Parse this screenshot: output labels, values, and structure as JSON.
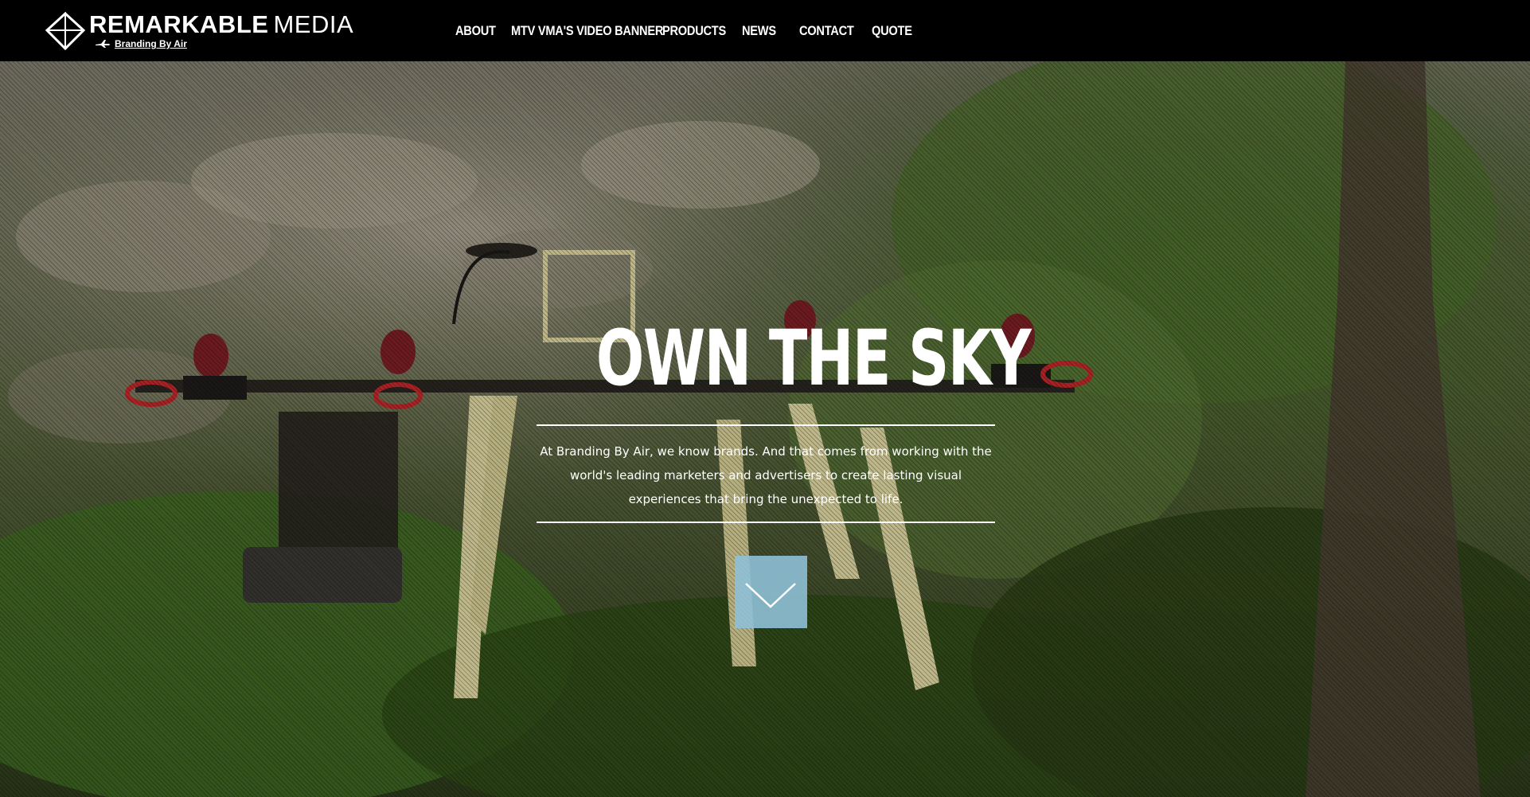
{
  "brand": {
    "name_bold": "REMARKABLE",
    "name_light": "MEDIA",
    "tagline": "Branding By Air",
    "logo_icon": "diamond-icon",
    "plane_icon": "plane-icon"
  },
  "nav": {
    "items": [
      {
        "label": "ABOUT"
      },
      {
        "label": "MTV VMA'S VIDEO BANNER"
      },
      {
        "label": "PRODUCTS"
      },
      {
        "label": "NEWS"
      },
      {
        "label": "CONTACT"
      },
      {
        "label": "QUOTE"
      }
    ]
  },
  "hero": {
    "headline": "OWN THE SKY",
    "description": "At Branding By Air, we know brands. And that comes from working with the world's leading marketers and advertisers to create lasting visual experiences that bring the unexpected to life.",
    "scroll_icon": "chevron-down-icon",
    "scroll_button_color": "#8EC0D6"
  },
  "colors": {
    "header_bg": "#000000",
    "text": "#FFFFFF",
    "accent": "#8EC0D6"
  }
}
